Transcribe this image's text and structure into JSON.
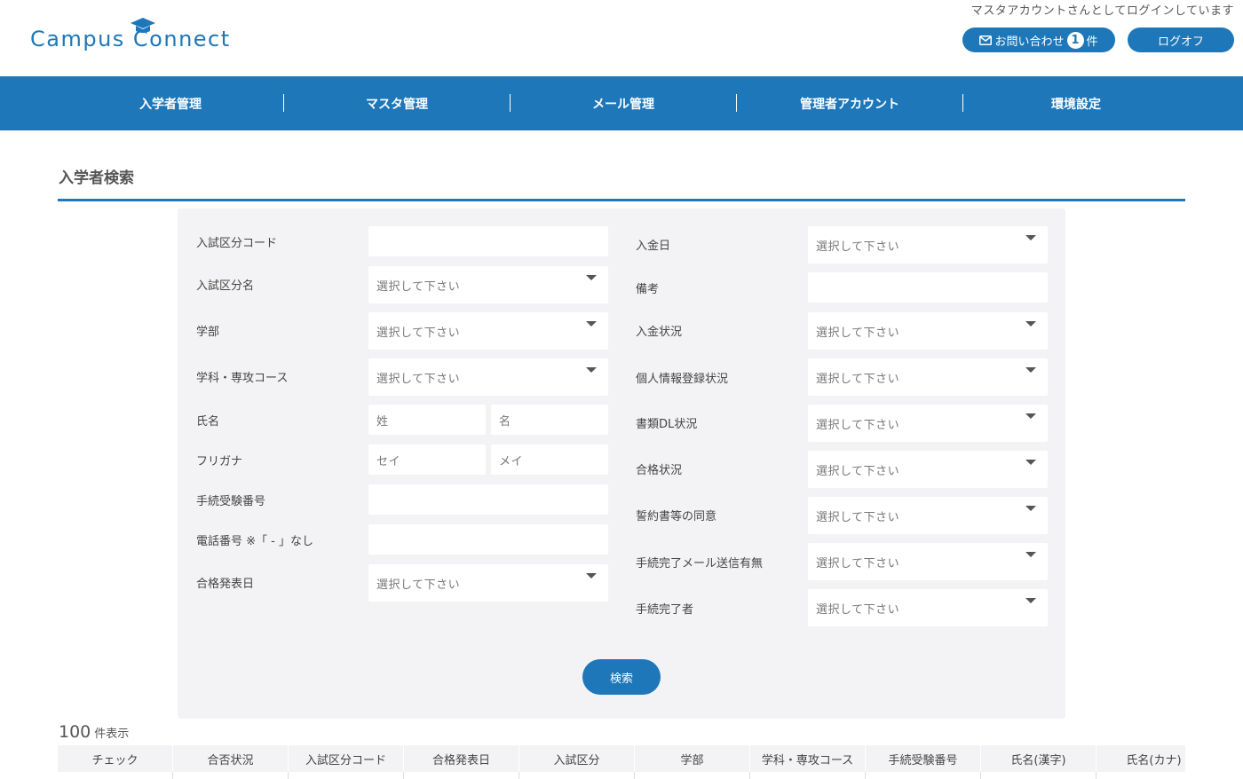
{
  "header": {
    "logo_text": "Campus Connect",
    "login_user": "マスタアカウントさんとしてログインしています",
    "contact_label": "お問い合わせ",
    "contact_count": "1",
    "contact_unit": "件",
    "logout_label": "ログオフ"
  },
  "nav": {
    "items": [
      "入学者管理",
      "マスタ管理",
      "メール管理",
      "管理者アカウント",
      "環境設定"
    ]
  },
  "page_title": "入学者検索",
  "search": {
    "left": {
      "exam_code_label": "入試区分コード",
      "exam_name_label": "入試区分名",
      "exam_name_value": "選択して下さい",
      "faculty_label": "学部",
      "faculty_value": "選択して下さい",
      "course_label": "学科・専攻コース",
      "course_value": "選択して下さい",
      "name_label": "氏名",
      "name_last_placeholder": "姓",
      "name_first_placeholder": "名",
      "kana_label": "フリガナ",
      "kana_last_placeholder": "セイ",
      "kana_first_placeholder": "メイ",
      "procedure_no_label": "手続受験番号",
      "phone_label": "電話番号 ※「 - 」なし",
      "pass_date_label": "合格発表日",
      "pass_date_value": "選択して下さい"
    },
    "right": {
      "payment_date_label": "入金日",
      "payment_date_value": "選択して下さい",
      "note_label": "備考",
      "payment_status_label": "入金状況",
      "payment_status_value": "選択して下さい",
      "personal_info_label": "個人情報登録状況",
      "personal_info_value": "選択して下さい",
      "doc_dl_label": "書類DL状況",
      "doc_dl_value": "選択して下さい",
      "pass_status_label": "合格状況",
      "pass_status_value": "選択して下さい",
      "pledge_label": "誓約書等の同意",
      "pledge_value": "選択して下さい",
      "mail_sent_label": "手続完了メール送信有無",
      "mail_sent_value": "選択して下さい",
      "completed_by_label": "手続完了者",
      "completed_by_value": "選択して下さい"
    },
    "submit_label": "検索"
  },
  "results": {
    "count": "100",
    "count_unit": "件表示",
    "columns": [
      "チェック",
      "合否状況",
      "入試区分コード",
      "合格発表日",
      "入試区分",
      "学部",
      "学科・専攻コース",
      "手続受験番号",
      "氏名(漢字)",
      "氏名(カナ)"
    ]
  },
  "colors": {
    "brand": "#1d77b8",
    "panel_bg": "#f3f3f5"
  }
}
